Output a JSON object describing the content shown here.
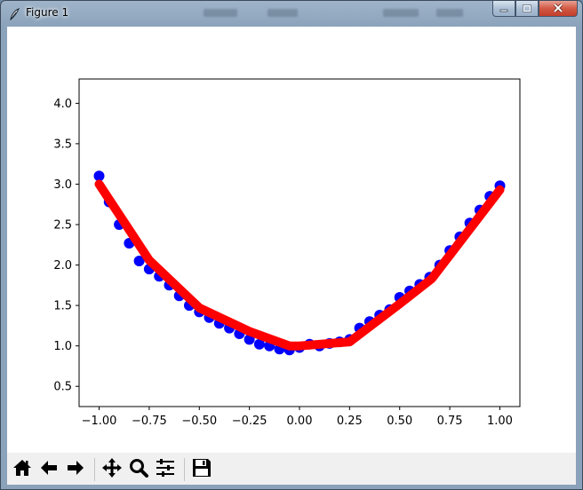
{
  "window": {
    "title": "Figure 1",
    "icon": "feather-icon",
    "controls": [
      "minimize-icon",
      "maximize-icon",
      "close-icon"
    ]
  },
  "toolbar": {
    "buttons": [
      {
        "name": "home",
        "icon": "home-icon"
      },
      {
        "name": "back",
        "icon": "arrow-left-icon"
      },
      {
        "name": "forward",
        "icon": "arrow-right-icon"
      },
      {
        "name": "pan",
        "icon": "move-icon"
      },
      {
        "name": "zoom",
        "icon": "magnifier-icon"
      },
      {
        "name": "configure-subplots",
        "icon": "sliders-icon"
      },
      {
        "name": "save",
        "icon": "floppy-disk-icon"
      }
    ]
  },
  "chart_data": {
    "type": "scatter",
    "title": "",
    "xlabel": "",
    "ylabel": "",
    "xlim": [
      -1.1,
      1.1
    ],
    "ylim": [
      0.25,
      4.3
    ],
    "xticks": [
      -1.0,
      -0.75,
      -0.5,
      -0.25,
      0.0,
      0.25,
      0.5,
      0.75,
      1.0
    ],
    "xtick_labels": [
      "−1.00",
      "−0.75",
      "−0.50",
      "−0.25",
      "0.00",
      "0.25",
      "0.50",
      "0.75",
      "1.00"
    ],
    "yticks": [
      0.5,
      1.0,
      1.5,
      2.0,
      2.5,
      3.0,
      3.5,
      4.0
    ],
    "ytick_labels": [
      "0.5",
      "1.0",
      "1.5",
      "2.0",
      "2.5",
      "3.0",
      "3.5",
      "4.0"
    ],
    "grid": false,
    "series": [
      {
        "kind": "scatter",
        "color": "#0000ff",
        "x": [
          -1.0,
          -0.95,
          -0.9,
          -0.85,
          -0.8,
          -0.75,
          -0.7,
          -0.65,
          -0.6,
          -0.55,
          -0.5,
          -0.45,
          -0.4,
          -0.35,
          -0.3,
          -0.25,
          -0.2,
          -0.15,
          -0.1,
          -0.05,
          0.0,
          0.05,
          0.1,
          0.15,
          0.2,
          0.25,
          0.3,
          0.35,
          0.4,
          0.45,
          0.5,
          0.55,
          0.6,
          0.65,
          0.7,
          0.75,
          0.8,
          0.85,
          0.9,
          0.95,
          1.0
        ],
        "y": [
          3.1,
          2.78,
          2.5,
          2.27,
          2.05,
          1.95,
          1.86,
          1.75,
          1.62,
          1.5,
          1.42,
          1.35,
          1.28,
          1.22,
          1.15,
          1.08,
          1.02,
          1.0,
          0.96,
          0.95,
          0.98,
          1.02,
          1.0,
          1.03,
          1.05,
          1.08,
          1.22,
          1.3,
          1.38,
          1.45,
          1.6,
          1.68,
          1.76,
          1.85,
          2.0,
          2.18,
          2.35,
          2.52,
          2.68,
          2.85,
          2.98
        ]
      },
      {
        "kind": "line",
        "color": "#ff0000",
        "x": [
          -1.0,
          -0.75,
          -0.5,
          -0.25,
          -0.05,
          0.0,
          0.25,
          0.5,
          0.66,
          1.0
        ],
        "y": [
          3.0,
          2.06,
          1.47,
          1.18,
          1.0,
          1.0,
          1.05,
          1.52,
          1.83,
          2.93
        ]
      }
    ]
  }
}
